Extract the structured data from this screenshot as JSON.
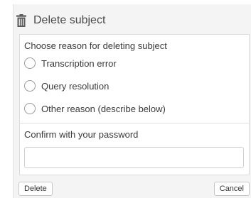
{
  "dialog": {
    "title": "Delete subject",
    "icon": "trash-icon"
  },
  "reason": {
    "label": "Choose reason for deleting subject",
    "options": [
      {
        "label": "Transcription error",
        "selected": false
      },
      {
        "label": "Query resolution",
        "selected": false
      },
      {
        "label": "Other reason (describe below)",
        "selected": false
      }
    ]
  },
  "confirm": {
    "label": "Confirm with your password",
    "password_value": "",
    "placeholder": ""
  },
  "buttons": {
    "delete_label": "Delete",
    "cancel_label": "Cancel"
  },
  "colors": {
    "dialog_background": "#f4f4f4",
    "panel_background": "#ffffff",
    "border": "#dcdcdc",
    "text": "#333333"
  }
}
